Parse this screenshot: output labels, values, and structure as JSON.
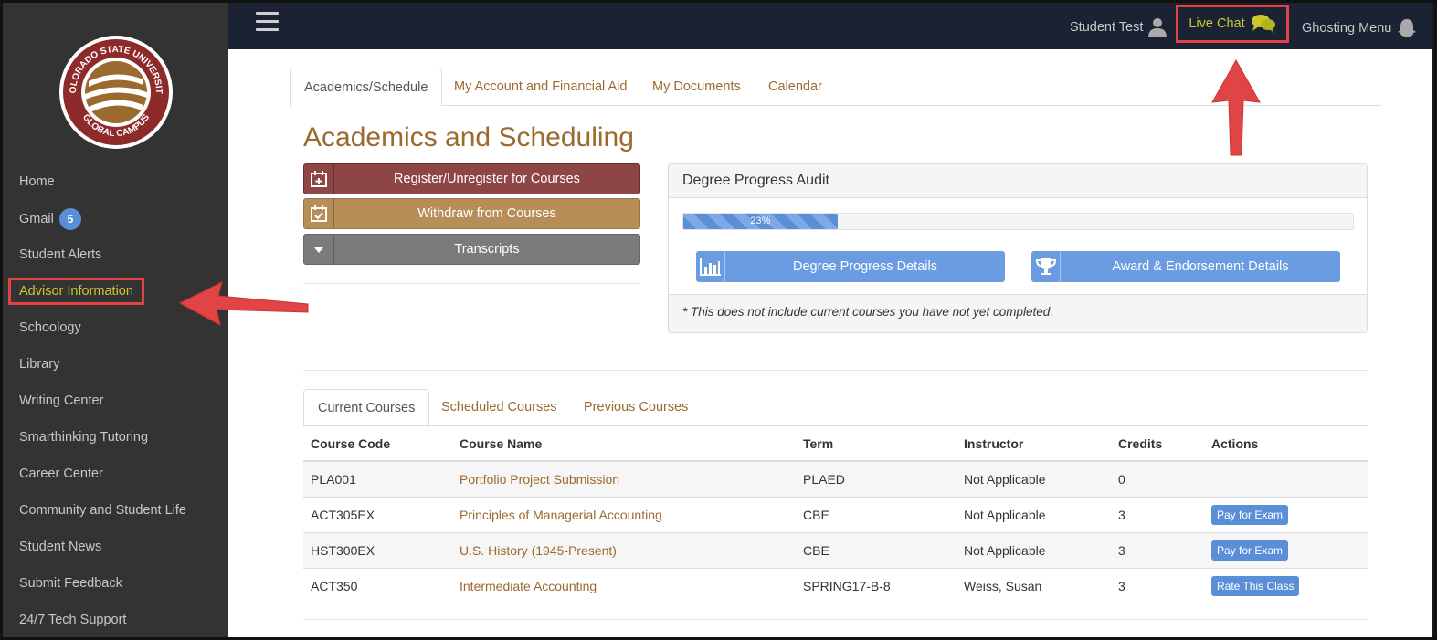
{
  "sidebar": {
    "logo": {
      "icon": "csu-global-logo",
      "text_top": "COLORADO STATE UNIVERSITY",
      "text_bottom": "GLOBAL CAMPUS"
    },
    "items": [
      {
        "label": "Home"
      },
      {
        "label": "Gmail",
        "badge": "5"
      },
      {
        "label": "Student Alerts"
      },
      {
        "label": "Advisor Information",
        "highlighted": true
      },
      {
        "label": "Schoology"
      },
      {
        "label": "Library"
      },
      {
        "label": "Writing Center"
      },
      {
        "label": "Smarthinking Tutoring"
      },
      {
        "label": "Career Center"
      },
      {
        "label": "Community and Student Life"
      },
      {
        "label": "Student News"
      },
      {
        "label": "Submit Feedback"
      },
      {
        "label": "24/7 Tech Support"
      }
    ]
  },
  "topbar": {
    "menu_icon": "hamburger-icon",
    "user_label": "Student Test",
    "live_chat_label": "Live Chat",
    "ghosting_label": "Ghosting Menu"
  },
  "tabs": [
    {
      "label": "Academics/Schedule",
      "active": true
    },
    {
      "label": "My Account and Financial Aid"
    },
    {
      "label": "My Documents"
    },
    {
      "label": "Calendar"
    }
  ],
  "page_title": "Academics and Scheduling",
  "actions": {
    "register": "Register/Unregister for Courses",
    "withdraw": "Withdraw from Courses",
    "transcripts": "Transcripts"
  },
  "degree_panel": {
    "title": "Degree Progress Audit",
    "progress_percent": 23,
    "progress_label": "23%",
    "details_button": "Degree Progress Details",
    "award_button": "Award & Endorsement Details",
    "note": "* This does not include current courses you have not yet completed."
  },
  "course_tabs": [
    {
      "label": "Current Courses",
      "active": true
    },
    {
      "label": "Scheduled Courses"
    },
    {
      "label": "Previous Courses"
    }
  ],
  "table": {
    "headers": [
      "Course Code",
      "Course Name",
      "Term",
      "Instructor",
      "Credits",
      "Actions"
    ],
    "rows": [
      {
        "code": "PLA001",
        "name": "Portfolio Project Submission",
        "term": "PLAED",
        "instructor": "Not Applicable",
        "credits": "0",
        "action": ""
      },
      {
        "code": "ACT305EX",
        "name": "Principles of Managerial Accounting",
        "term": "CBE",
        "instructor": "Not Applicable",
        "credits": "3",
        "action": "Pay for Exam"
      },
      {
        "code": "HST300EX",
        "name": "U.S. History (1945-Present)",
        "term": "CBE",
        "instructor": "Not Applicable",
        "credits": "3",
        "action": "Pay for Exam"
      },
      {
        "code": "ACT350",
        "name": "Intermediate Accounting",
        "term": "SPRING17-B-8",
        "instructor": "Weiss, Susan",
        "credits": "3",
        "action": "Rate This Class"
      }
    ]
  },
  "colors": {
    "brand_brown": "#9b6a2e",
    "sidebar_bg": "#333333",
    "topbar_bg": "#1b2233",
    "highlight_red": "#e04444",
    "accent_blue": "#5a8fd8"
  }
}
